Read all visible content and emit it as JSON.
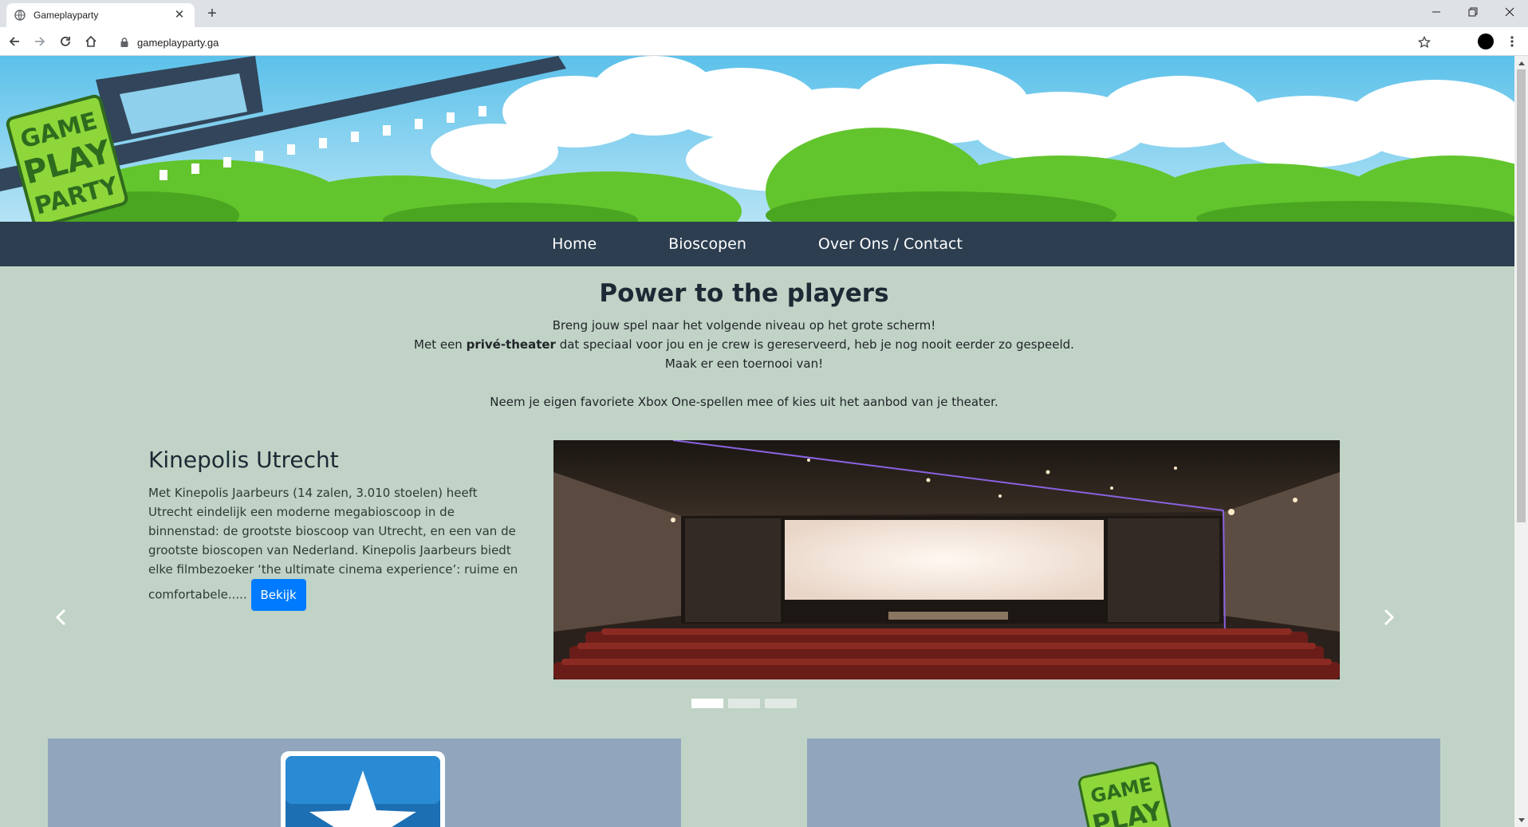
{
  "browser": {
    "tab_title": "Gameplayparty",
    "tab_close": "✕",
    "new_tab": "+",
    "url": "gameplayparty.ga"
  },
  "site": {
    "logo_text": "GAME PLAY PARTY",
    "nav": [
      "Home",
      "Bioscopen",
      "Over Ons / Contact"
    ]
  },
  "hero": {
    "title": "Power to the players",
    "line1": "Breng jouw spel naar het volgende niveau op het grote scherm!",
    "line2_pre": "Met een ",
    "line2_bold": "privé-theater",
    "line2_post": " dat speciaal voor jou en je crew is gereserveerd, heb je nog nooit eerder zo gespeeld.",
    "line3": "Maak er een toernooi van!",
    "line4": "Neem je eigen favoriete Xbox One-spellen mee of kies uit het aanbod van je theater."
  },
  "carousel": {
    "slide_title": "Kinepolis Utrecht",
    "slide_text": "Met Kinepolis Jaarbeurs (14 zalen, 3.010 stoelen) heeft Utrecht eindelijk een moderne megabioscoop in de binnenstad: de grootste bioscoop van Utrecht, en een van de grootste bioscopen van Nederland. Kinepolis Jaarbeurs biedt elke filmbezoeker ‘the ultimate cinema experience’: ruime en comfortabele.....",
    "button_label": "Bekijk",
    "prev_icon": "chevron-left-icon",
    "next_icon": "chevron-right-icon",
    "slide_count": 3,
    "active_slide": 1
  },
  "cards": {
    "right_logo_text": "GAME PLAY"
  },
  "colors": {
    "navbar": "#2c3e50",
    "page_bg": "#c0d3c6",
    "button": "#007bff",
    "card": "#91a6bd",
    "logo_green": "#8ed63a"
  }
}
